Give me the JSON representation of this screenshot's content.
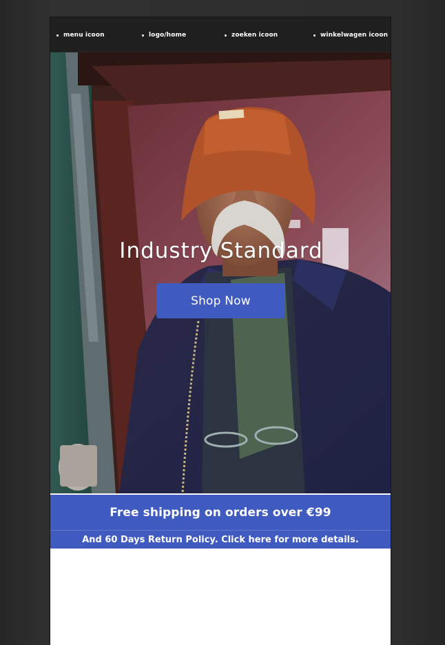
{
  "nav": {
    "items": [
      {
        "label": "menu icoon"
      },
      {
        "label": "logo/home"
      },
      {
        "label": "zoeken icoon"
      },
      {
        "label": "winkelwagen icoon"
      }
    ]
  },
  "hero": {
    "title": "Industry Standard",
    "button_label": "Shop Now"
  },
  "banner": {
    "headline": "Free shipping on orders over €99",
    "subline": "And 60 Days Return Policy. Click here for more details."
  },
  "colors": {
    "accent": "#3f5bbf",
    "nav_bg": "#1f1f1f",
    "backdrop": "#2b2b2b"
  }
}
